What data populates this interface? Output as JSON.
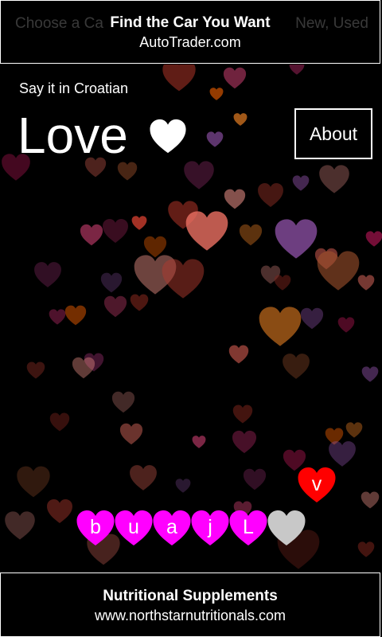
{
  "ad_top": {
    "ghost_left": "Choose a Ca",
    "ghost_right": "New, Used",
    "title": "Find the Car You Want",
    "url": "AutoTrader.com"
  },
  "header": {
    "subtitle": "Say it in Croatian",
    "word": "Love",
    "heart_icon": "heart-icon"
  },
  "about_button": {
    "label": "About"
  },
  "letter_tiles": [
    {
      "letter": "b",
      "color": "#ff00ff"
    },
    {
      "letter": "u",
      "color": "#ff00ff"
    },
    {
      "letter": "a",
      "color": "#ff00ff"
    },
    {
      "letter": "j",
      "color": "#ff00ff"
    },
    {
      "letter": "L",
      "color": "#ff00ff"
    },
    {
      "letter": "",
      "color": "#c8c8c8"
    }
  ],
  "falling_heart": {
    "letter": "v",
    "color": "#ff0000"
  },
  "ad_bottom": {
    "title": "Nutritional Supplements",
    "url": "www.northstarnutritionals.com"
  },
  "colors": {
    "background": "#000000",
    "text": "#ffffff",
    "tile": "#ff00ff",
    "empty_tile": "#c8c8c8",
    "falling": "#ff0000"
  }
}
